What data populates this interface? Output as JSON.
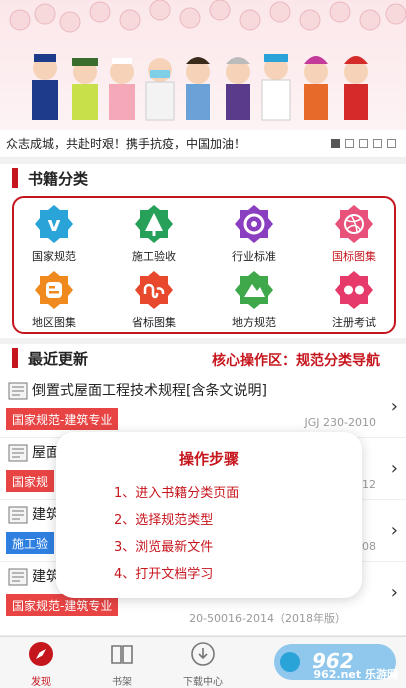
{
  "banner": {
    "caption": "众志成城，共赴时艰！携手抗疫，中国加油！",
    "slides": 5,
    "active_slide": 1
  },
  "categories_section": {
    "title": "书籍分类",
    "items": [
      {
        "label": "国家规范",
        "icon": "vimeo-icon",
        "color": "#2aa3d8"
      },
      {
        "label": "施工验收",
        "icon": "tree-icon",
        "color": "#27a05a"
      },
      {
        "label": "行业标准",
        "icon": "aperture-icon",
        "color": "#8a3fc0"
      },
      {
        "label": "国标图集",
        "icon": "dribbble-icon",
        "color": "#e8517a"
      },
      {
        "label": "地区图集",
        "icon": "blogger-icon",
        "color": "#f08a1e"
      },
      {
        "label": "省标图集",
        "icon": "stumbleupon-icon",
        "color": "#e8492c"
      },
      {
        "label": "地方规范",
        "icon": "mountain-icon",
        "color": "#3ea84a"
      },
      {
        "label": "注册考试",
        "icon": "flickr-icon",
        "color": "#e53a6a"
      }
    ]
  },
  "recent_section": {
    "title": "最近更新",
    "core_label": "核心操作区：规范分类导航",
    "rows": [
      {
        "title": "倒置式屋面工程技术规程[含条文说明]",
        "tag": "国家规范-建筑专业",
        "code": "JGJ 230-2010"
      },
      {
        "title": "屋面",
        "tag": "国家规",
        "code": "12"
      },
      {
        "title": "建筑",
        "tag": "施工验",
        "code": "08"
      },
      {
        "title": "建筑",
        "tag": "国家规范-建筑专业",
        "code": "20-50016-2014（2018年版）"
      }
    ]
  },
  "overlay": {
    "title": "操作步骤",
    "steps": [
      "1、进入书籍分类页面",
      "2、选择规范类型",
      "3、浏览最新文件",
      "4、打开文档学习"
    ]
  },
  "bottom_nav": {
    "items": [
      {
        "label": "发现",
        "icon": "compass-icon",
        "active": true
      },
      {
        "label": "书架",
        "icon": "book-icon",
        "active": false
      },
      {
        "label": "下载中心",
        "icon": "download-icon",
        "active": false
      },
      {
        "label": "",
        "icon": "",
        "active": false
      },
      {
        "label": "",
        "icon": "",
        "active": false
      }
    ]
  },
  "watermark": {
    "text": "962.net",
    "sub": "乐游网"
  },
  "colors": {
    "accent": "#c6161d",
    "tag_red": "#e84444",
    "tag_blue": "#2f7fe0"
  }
}
